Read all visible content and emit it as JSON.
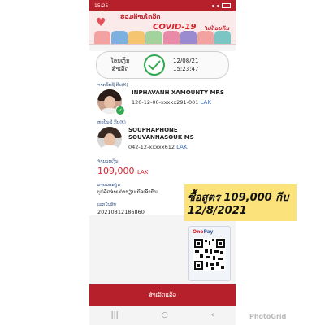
{
  "status_bar": {
    "time": "15:25"
  },
  "banner": {
    "line1": "ຮ່ວມຕ້ານໂຄວິດ",
    "covid_text": "COVID-19",
    "line3": "ໄປດ້ວຍກັນ"
  },
  "transaction": {
    "status_label_1": "ໂອນເງິນ",
    "status_label_2": "ສຳເລັດ",
    "date": "12/08/21",
    "time": "15:23:47"
  },
  "sender": {
    "label": "ຈາກບັນຊີ ກີບ(₭)",
    "name": "INPHAVANH XAMOUNTY MRS",
    "account": "120-12-00-xxxxx291-001",
    "currency": "LAK"
  },
  "receiver": {
    "label": "ຫາບັນຊີ ກີບ(₭)",
    "name": "SOUPHAPHONE SOUVANNASOUK MS",
    "account": "042-12-xxxxx612",
    "currency": "LAK"
  },
  "amount": {
    "label": "ຈຳນວນເງິນ",
    "value": "109,000",
    "currency": "LAK"
  },
  "description": {
    "label": "ລາຍລະອຽດ",
    "value": "ບຸກໍລັດຈ່າຍຄ່າຮຽນເຄືອເອົ້າຄົ້ນ"
  },
  "reference": {
    "label": "ເລກໃບຮັບ",
    "value": "20210812186860"
  },
  "qr": {
    "brand_one": "One",
    "brand_rest": "Pay"
  },
  "bottom_button": {
    "label": "ສຳເລັດແລ້ວ"
  },
  "overlay_note": {
    "line1": "ซื้อสูตร 109,000 กีบ",
    "line2": "12/8/2021"
  },
  "watermark": "PhotoGrid",
  "colors": {
    "brand_red": "#b5202a",
    "success_green": "#2fa84f",
    "amount_red": "#d8232f",
    "note_yellow": "#fbe27a"
  }
}
